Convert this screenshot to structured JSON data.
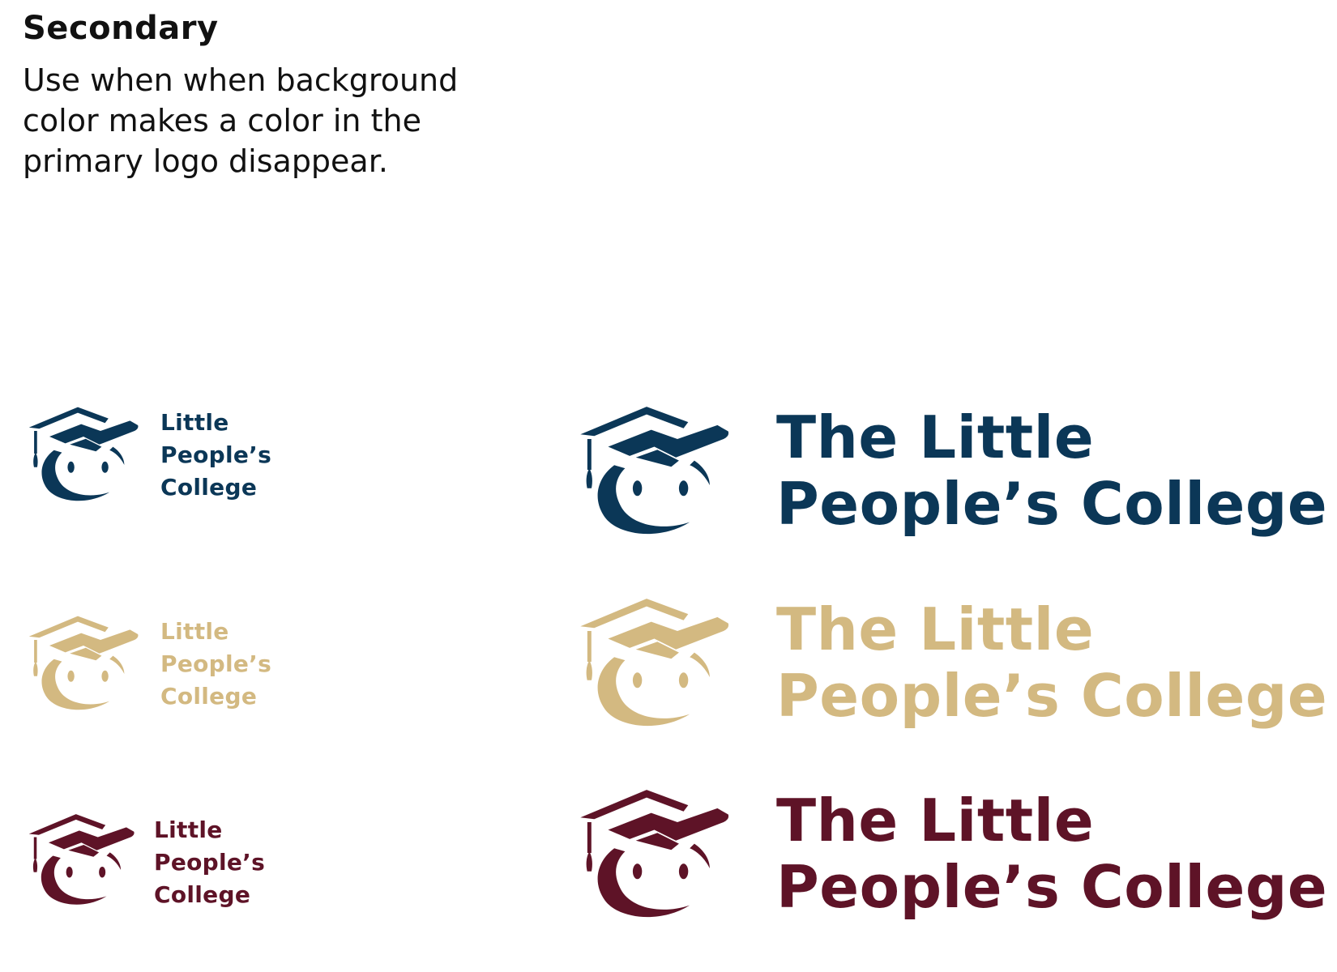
{
  "heading": "Secondary",
  "description": "Use when when background color makes a color in the primary logo disappear.",
  "colors": {
    "navy": "#0b3757",
    "gold": "#d3b981",
    "maroon": "#5e1327"
  },
  "logos_small": [
    {
      "color": "#0b3757",
      "lines": [
        "Little",
        "People’s",
        "College"
      ]
    },
    {
      "color": "#d3b981",
      "lines": [
        "Little",
        "People’s",
        "College"
      ]
    },
    {
      "color": "#5e1327",
      "lines": [
        "Little",
        "People’s",
        "College"
      ]
    }
  ],
  "logos_large": [
    {
      "color": "#0b3757",
      "lines": [
        "The Little",
        "People’s College"
      ]
    },
    {
      "color": "#d3b981",
      "lines": [
        "The Little",
        "People’s College"
      ]
    },
    {
      "color": "#5e1327",
      "lines": [
        "The Little",
        "People’s College"
      ]
    }
  ]
}
